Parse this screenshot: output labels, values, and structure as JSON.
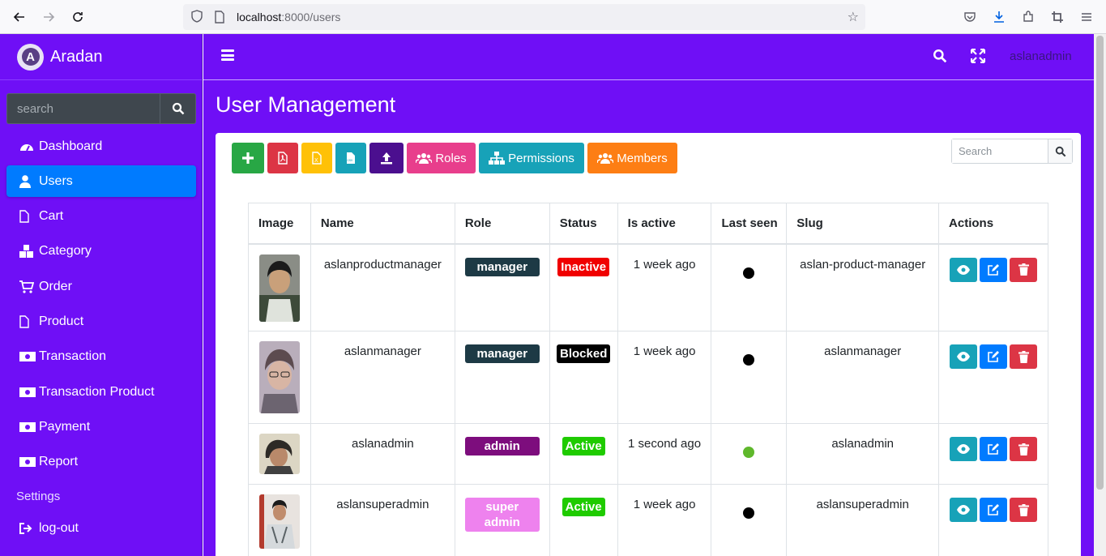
{
  "browser": {
    "url_host": "localhost",
    "url_path": ":8000/users"
  },
  "sidebar": {
    "brand": "Aradan",
    "brand_letter": "A",
    "search_placeholder": "search",
    "items": [
      {
        "label": "Dashboard",
        "icon": "tachometer-icon"
      },
      {
        "label": "Users",
        "icon": "user-icon",
        "active": true
      },
      {
        "label": "Cart",
        "icon": "file-icon"
      },
      {
        "label": "Category",
        "icon": "cubes-icon"
      },
      {
        "label": "Order",
        "icon": "cart-icon"
      },
      {
        "label": "Product",
        "icon": "file-icon"
      },
      {
        "label": "Transaction",
        "icon": "money-icon"
      },
      {
        "label": "Transaction Product",
        "icon": "money-icon"
      },
      {
        "label": "Payment",
        "icon": "money-icon"
      },
      {
        "label": "Report",
        "icon": "money-icon"
      }
    ],
    "settings_header": "Settings",
    "logout_label": "log-out"
  },
  "topnav": {
    "username": "aslanadmin"
  },
  "page": {
    "title": "User Management"
  },
  "toolbar": {
    "roles_label": "Roles",
    "permissions_label": "Permissions",
    "members_label": "Members",
    "xls_glyph": "X",
    "csv_glyph": "csv"
  },
  "table_search": {
    "placeholder": "Search"
  },
  "table": {
    "columns": [
      "Image",
      "Name",
      "Role",
      "Status",
      "Is active",
      "Last seen",
      "Slug",
      "Actions"
    ],
    "rows": [
      {
        "name": "aslanproductmanager",
        "role": "manager",
        "role_color": "#1d3a45",
        "status": "Inactive",
        "status_color": "#f00000",
        "is_active": "1 week ago",
        "online": false,
        "slug": "aslan-product-manager"
      },
      {
        "name": "aslanmanager",
        "role": "manager",
        "role_color": "#1d3a45",
        "status": "Blocked",
        "status_color": "#000000",
        "is_active": "1 week ago",
        "online": false,
        "slug": "aslanmanager"
      },
      {
        "name": "aslanadmin",
        "role": "admin",
        "role_color": "#7d0d7d",
        "status": "Active",
        "status_color": "#1fcb00",
        "is_active": "1 second ago",
        "online": true,
        "slug": "aslanadmin"
      },
      {
        "name": "aslansuperadmin",
        "role": "super admin",
        "role_color": "#ee82ee",
        "status": "Active",
        "status_color": "#1fcb00",
        "is_active": "1 week ago",
        "online": false,
        "slug": "aslansuperadmin"
      }
    ]
  },
  "colors": {
    "primary": "#6f0ff6",
    "active_item": "#007bff",
    "online_dot": "#5fb82c",
    "offline_dot": "#000000"
  }
}
